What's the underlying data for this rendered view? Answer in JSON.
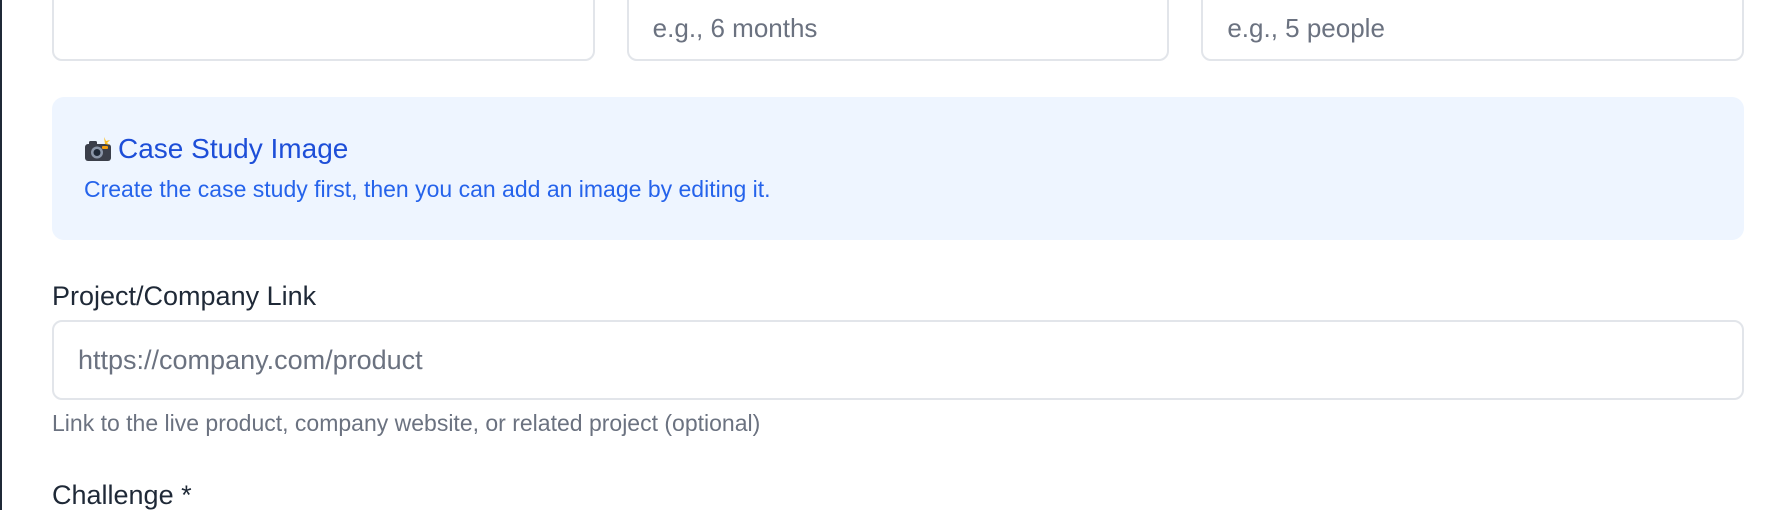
{
  "form": {
    "top_inputs": [
      {
        "placeholder": ""
      },
      {
        "placeholder": "e.g., 6 months"
      },
      {
        "placeholder": "e.g., 5 people"
      }
    ],
    "image_notice": {
      "icon": "camera-flash-icon",
      "title": "Case Study Image",
      "message": "Create the case study first, then you can add an image by editing it."
    },
    "link_field": {
      "label": "Project/Company Link",
      "placeholder": "https://company.com/product",
      "value": "",
      "help": "Link to the live product, company website, or related project (optional)"
    },
    "challenge_field": {
      "label": "Challenge *"
    }
  },
  "colors": {
    "notice_background": "#eef5ff",
    "notice_text": "#2563eb",
    "input_border": "#e2e5ea",
    "placeholder": "#6b7280"
  }
}
